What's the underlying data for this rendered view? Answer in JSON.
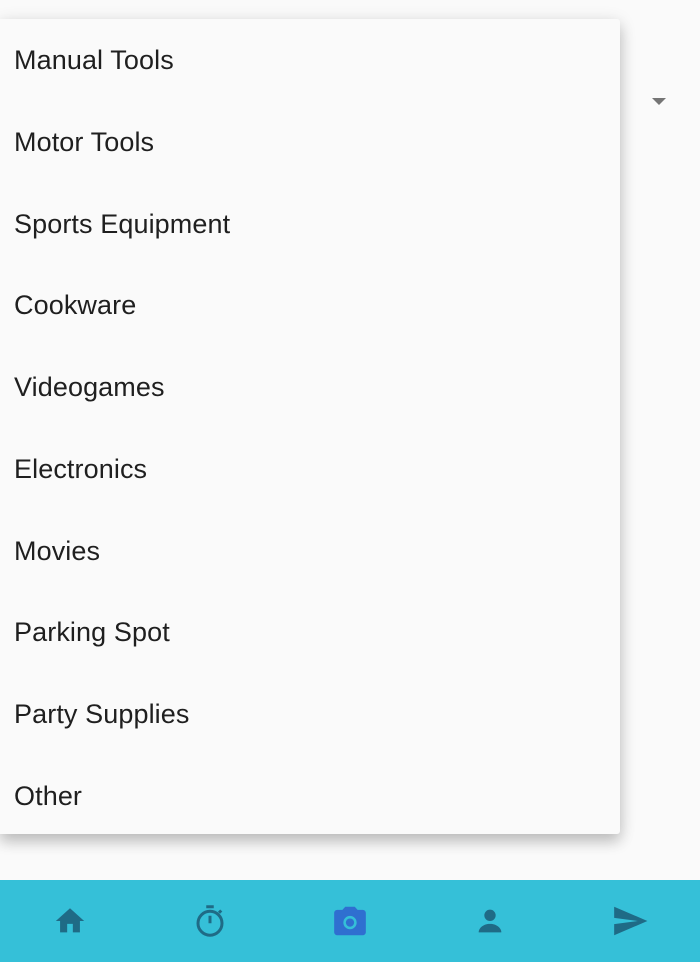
{
  "menu": {
    "items": [
      {
        "label": "Manual Tools"
      },
      {
        "label": "Motor Tools"
      },
      {
        "label": "Sports Equipment"
      },
      {
        "label": "Cookware"
      },
      {
        "label": "Videogames"
      },
      {
        "label": "Electronics"
      },
      {
        "label": "Movies"
      },
      {
        "label": "Parking Spot"
      },
      {
        "label": "Party Supplies"
      },
      {
        "label": "Other"
      }
    ]
  },
  "bottom_nav": {
    "background": "#35c0d8",
    "items": [
      {
        "icon": "home-icon",
        "active": false
      },
      {
        "icon": "timer-icon",
        "active": false
      },
      {
        "icon": "camera-icon",
        "active": true
      },
      {
        "icon": "person-icon",
        "active": false
      },
      {
        "icon": "send-icon",
        "active": false
      }
    ],
    "active_color": "#2f6fd0",
    "inactive_color": "#1f6b86"
  }
}
